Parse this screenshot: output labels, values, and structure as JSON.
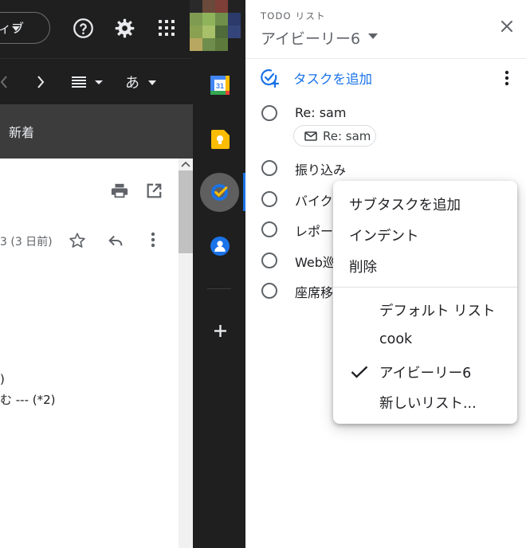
{
  "gmail": {
    "filter_chip": "ィブ",
    "sort_icon_label": "あ",
    "new_mail_label": "新着",
    "mail_date": "3 (3 日前)",
    "body_line1": ")",
    "body_line2": "む --- (*2)"
  },
  "tasks": {
    "header_label": "TODO リスト",
    "list_name": "アイビーリー6",
    "add_task": "タスクを追加",
    "items": [
      {
        "title": "Re: sam"
      },
      {
        "title": "振り込み"
      },
      {
        "title": "バイク"
      },
      {
        "title": "レポー"
      },
      {
        "title": "Web巡"
      },
      {
        "title": "座席移"
      }
    ],
    "linked_email_chip": "Re: sam"
  },
  "context_menu": {
    "actions": [
      "サブタスクを追加",
      "インデント",
      "削除"
    ],
    "lists": [
      "デフォルト リスト",
      "cook",
      "アイビーリー6",
      "新しいリスト..."
    ],
    "selected_list": "アイビーリー6"
  },
  "colors": {
    "accent": "#1a73e8",
    "dark_bg": "#1f1f1f",
    "text_primary": "#202124",
    "text_secondary": "#5f6368"
  },
  "icons": {
    "help": "help-icon",
    "settings": "gear-icon",
    "apps": "apps-grid-icon",
    "calendar": "calendar-icon",
    "keep": "keep-icon",
    "tasks": "tasks-icon",
    "contacts": "contacts-icon",
    "add": "plus-icon"
  }
}
